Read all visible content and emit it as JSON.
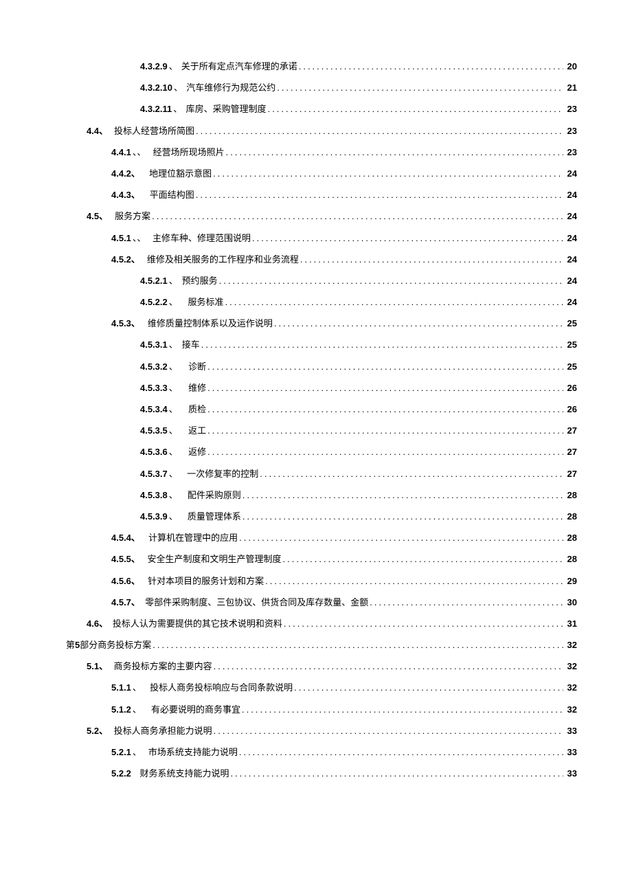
{
  "toc": [
    {
      "lvl": "d",
      "num": "4.3.2.9",
      "sep": "、",
      "gap": "small",
      "title": "关于所有定点汽车修理的承诺",
      "page": "20"
    },
    {
      "lvl": "d",
      "num": "4.3.2.10",
      "sep": "、",
      "gap": "small",
      "title": "汽车维修行为规范公约",
      "page": "21"
    },
    {
      "lvl": "d",
      "num": "4.3.2.11",
      "sep": "、",
      "gap": "small",
      "title": "库房、采购管理制度",
      "page": "23"
    },
    {
      "lvl": "b",
      "num": "4.4、",
      "sep": "",
      "gap": "med",
      "title": "投标人经营场所简图",
      "page": "23"
    },
    {
      "lvl": "c",
      "num": "4.4.1",
      "sep": "、、",
      "gap": "med",
      "title": "经营场所现场照片",
      "page": "23"
    },
    {
      "lvl": "c",
      "num": "4.4.2、",
      "sep": "",
      "gap": "big",
      "title": "地理位豁示意图",
      "page": "24"
    },
    {
      "lvl": "c",
      "num": "4.4.3、",
      "sep": "",
      "gap": "big",
      "title": "平面结构图",
      "page": "24"
    },
    {
      "lvl": "b",
      "num": "4.5、",
      "sep": "",
      "gap": "med",
      "title": "服务方案",
      "page": "24"
    },
    {
      "lvl": "c",
      "num": "4.5.1",
      "sep": "、、",
      "gap": "med",
      "title": "主修车种、修理范围说明",
      "page": "24"
    },
    {
      "lvl": "c",
      "num": "4.5.2、",
      "sep": "",
      "gap": "big",
      "title": "维修及相关服务的工作程序和业务流程",
      "page": "24"
    },
    {
      "lvl": "d",
      "num": "4.5.2.1",
      "sep": "、",
      "gap": "small",
      "title": "预约服务",
      "page": "24"
    },
    {
      "lvl": "d",
      "num": "4.5.2.2",
      "sep": "、",
      "gap": "big",
      "title": "服务标准",
      "page": "24"
    },
    {
      "lvl": "c",
      "num": "4.5.3、",
      "sep": "",
      "gap": "big",
      "title": "维修质量控制体系以及运作说明",
      "page": "25"
    },
    {
      "lvl": "d",
      "num": "4.5.3.1",
      "sep": "、",
      "gap": "small",
      "title": "接车",
      "page": "25"
    },
    {
      "lvl": "d",
      "num": "4.5.3.2",
      "sep": "、",
      "gap": "big",
      "title": "诊断",
      "page": "25"
    },
    {
      "lvl": "d",
      "num": "4.5.3.3",
      "sep": "、",
      "gap": "big",
      "title": "维修",
      "page": "26"
    },
    {
      "lvl": "d",
      "num": "4.5.3.4",
      "sep": "、",
      "gap": "big",
      "title": "质检",
      "page": "26"
    },
    {
      "lvl": "d",
      "num": "4.5.3.5",
      "sep": "、",
      "gap": "big",
      "title": "返工",
      "page": "27"
    },
    {
      "lvl": "d",
      "num": "4.5.3.6",
      "sep": "、",
      "gap": "big",
      "title": "返修",
      "page": "27"
    },
    {
      "lvl": "d",
      "num": "4.5.3.7",
      "sep": "、",
      "gap": "big",
      "title": "一次修复率的控制",
      "page": "27"
    },
    {
      "lvl": "d",
      "num": "4.5.3.8",
      "sep": "、",
      "gap": "big",
      "title": "配件采购原则",
      "page": "28"
    },
    {
      "lvl": "d",
      "num": "4.5.3.9",
      "sep": "、",
      "gap": "big",
      "title": "质量管理体系",
      "page": "28"
    },
    {
      "lvl": "c",
      "num": "4.5.4、",
      "sep": "",
      "gap": "big",
      "title": "计算机在管理中的应用",
      "page": "28"
    },
    {
      "lvl": "c",
      "num": "4.5.5、",
      "sep": "",
      "gap": "big",
      "title": "安全生产制度和文明生产管理制度",
      "page": "28"
    },
    {
      "lvl": "c",
      "num": "4.5.6、",
      "sep": "",
      "gap": "big",
      "title": "针对本项目的服务计划和方案",
      "page": "29"
    },
    {
      "lvl": "c",
      "num": "4.5.7、",
      "sep": "",
      "gap": "big",
      "title": "零部件采购制度、三包协议、供货合同及库存数量、金额",
      "page": "30"
    },
    {
      "lvl": "b",
      "num": "4.6、",
      "sep": "",
      "gap": "med",
      "title": "投标人认为需要提供的其它技术说明和资料",
      "page": "31"
    },
    {
      "lvl": "a",
      "num": "",
      "sep": "",
      "gap": "",
      "title_prefix": "第 ",
      "bold_inline": "5",
      "title_suffix": " 部分商务投标方案",
      "page": "32"
    },
    {
      "lvl": "b",
      "num": "5.1、",
      "sep": "",
      "gap": "med",
      "title": "商务投标方案的主要内容",
      "page": "32"
    },
    {
      "lvl": "c",
      "num": "5.1.1",
      "sep": "、",
      "gap": "big",
      "title": "投标人商务投标响应与合同条款说明",
      "page": "32"
    },
    {
      "lvl": "c",
      "num": "5.1.2",
      "sep": "、",
      "gap": "big",
      "title": "有必要说明的商务事宜",
      "page": "32"
    },
    {
      "lvl": "b",
      "num": "5.2、",
      "sep": "",
      "gap": "med",
      "title": "投标人商务承担能力说明",
      "page": "33"
    },
    {
      "lvl": "c",
      "num": "5.2.1",
      "sep": "、",
      "gap": "med",
      "title": "市场系统支持能力说明",
      "page": "33"
    },
    {
      "lvl": "c",
      "num": "5.2.2",
      "sep": "",
      "gap": "big",
      "title": "财务系统支持能力说明",
      "page": "33"
    }
  ]
}
